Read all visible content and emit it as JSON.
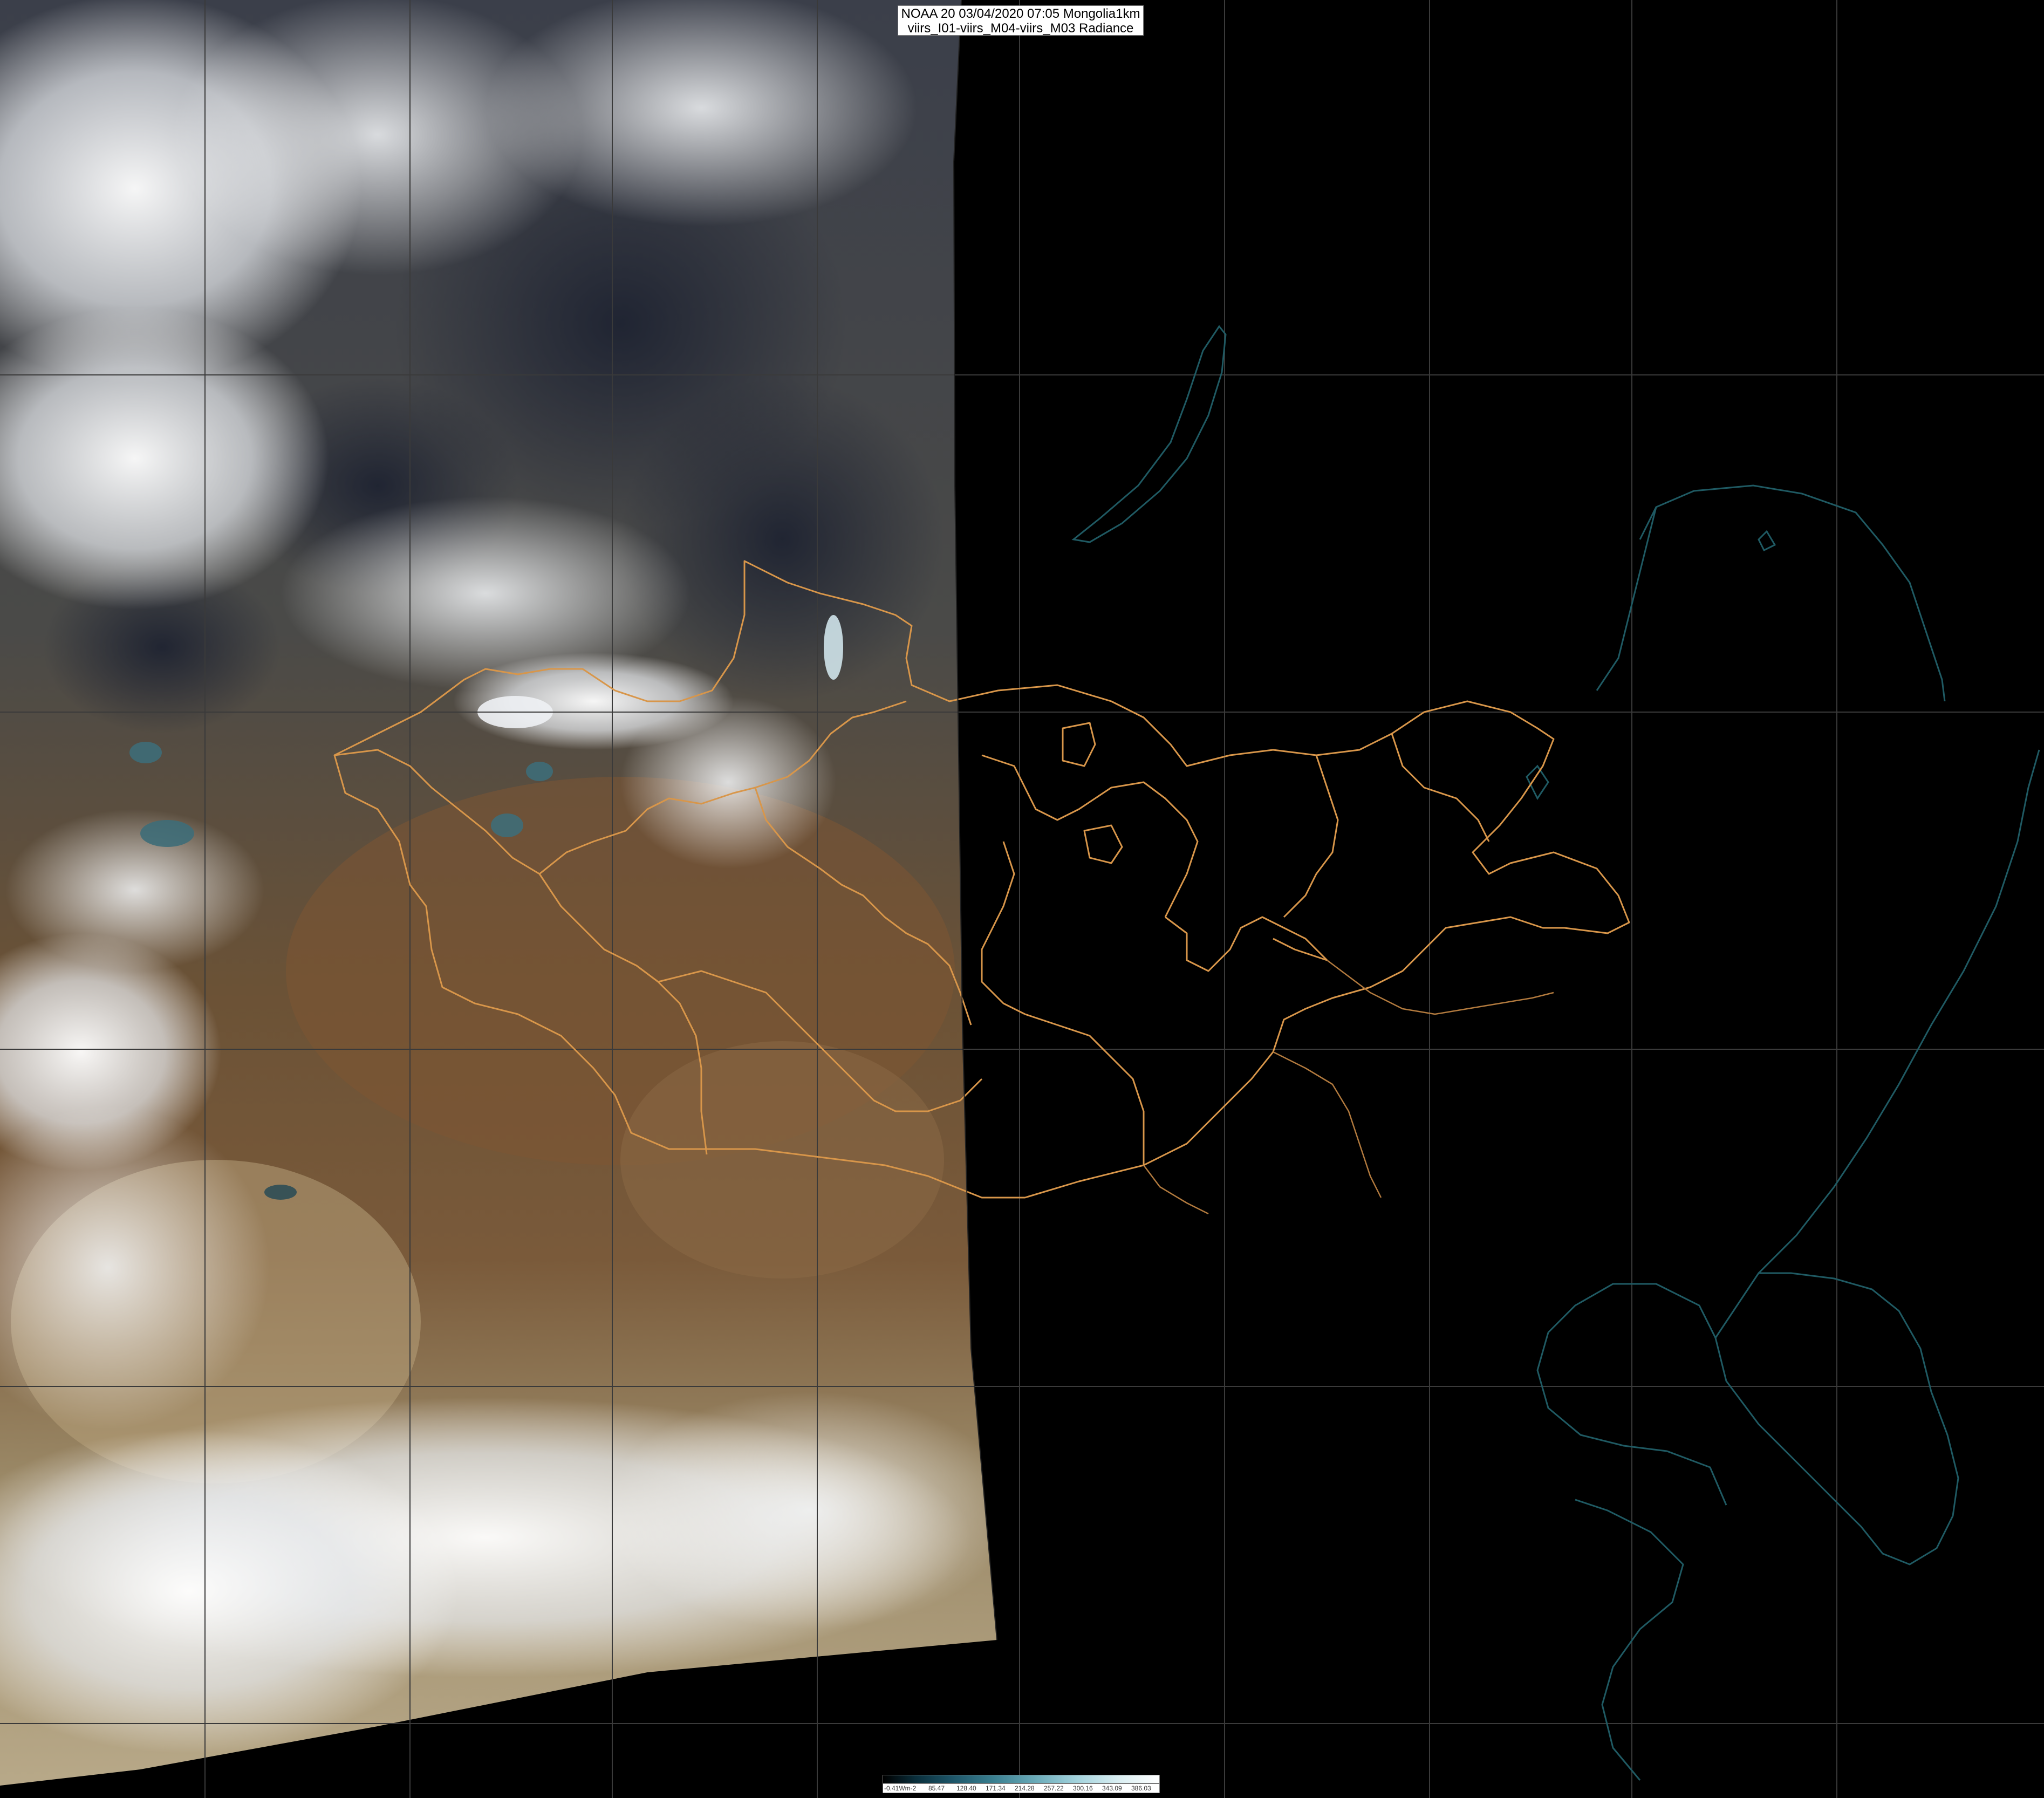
{
  "header": {
    "line1": "NOAA 20 03/04/2020 07:05 Mongolia1km",
    "line2": "viirs_I01-viirs_M04-viirs_M03 Radiance"
  },
  "colorbar": {
    "labels": [
      "-0.41Wm-2",
      "85.47",
      "128.40",
      "171.34",
      "214.28",
      "257.22",
      "300.16",
      "343.09",
      "386.03"
    ]
  },
  "map": {
    "background_color": "#000000",
    "grid_color": "#3a3a3a",
    "province_border_color": "#d8964a",
    "coastline_color": "#1f5a63"
  }
}
